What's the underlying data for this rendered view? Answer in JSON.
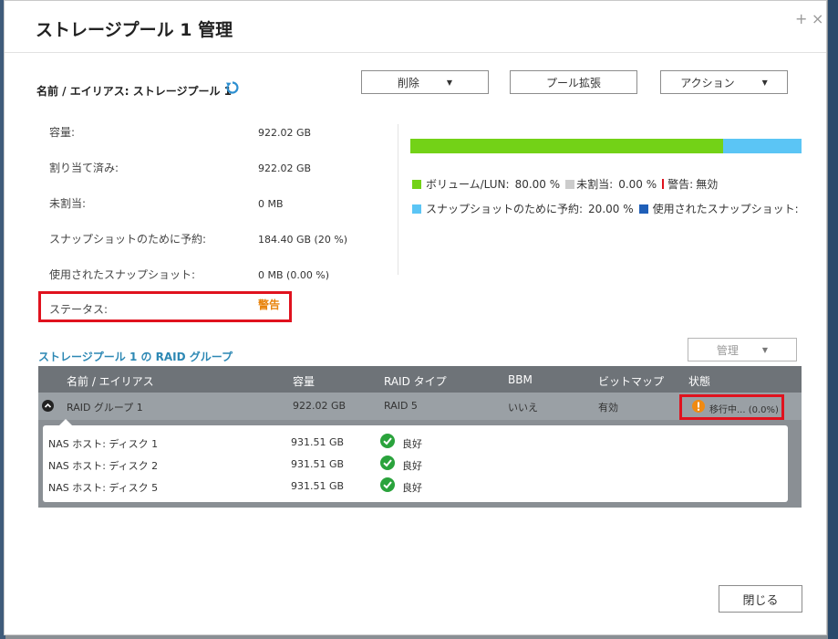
{
  "dialog": {
    "title": "ストレージプール 1 管理",
    "name_line": "名前 / エイリアス: ストレージプール 1"
  },
  "toolbar": {
    "delete_label": "削除",
    "expand_label": "プール拡張",
    "action_label": "アクション"
  },
  "info": {
    "rows": [
      {
        "label": "容量:",
        "value": "922.02 GB"
      },
      {
        "label": "割り当て済み:",
        "value": "922.02 GB"
      },
      {
        "label": "未割当:",
        "value": "0 MB"
      },
      {
        "label": "スナップショットのために予約:",
        "value": "184.40 GB (20 %)"
      },
      {
        "label": "使用されたスナップショット:",
        "value": "0 MB (0.00 %)"
      }
    ],
    "status_label": "ステータス:",
    "status_value": "警告"
  },
  "usage": {
    "volume_fraction": 0.8,
    "colors": {
      "volume": "#73d217",
      "unallocated": "#cccccc",
      "warning": "#e0121e",
      "snapshot_reserved": "#5bc5f5",
      "snapshot_used": "#1f5fb8"
    },
    "legend": {
      "volume": "ボリューム/LUN:",
      "volume_value": "80.00 %",
      "unallocated": "未割当:",
      "unallocated_value": "0.00 %",
      "warning": "警告:",
      "warning_value": "無効",
      "snapshot_reserved": "スナップショットのために予約:",
      "snapshot_reserved_value": "20.00 %",
      "snapshot_used": "使用されたスナップショット:"
    }
  },
  "raid": {
    "section_title": "ストレージプール 1 の RAID グループ",
    "manage_label": "管理",
    "columns": [
      "名前 / エイリアス",
      "容量",
      "RAID タイプ",
      "BBM",
      "ビットマップ",
      "状態"
    ],
    "group": {
      "name": "RAID グループ 1",
      "capacity": "922.02 GB",
      "raid_type": "RAID 5",
      "bbm": "いいえ",
      "bitmap": "有効",
      "state": "移行中... (0.0%)"
    },
    "disks": [
      {
        "name": "NAS ホスト: ディスク 1",
        "capacity": "931.51 GB",
        "status": "良好"
      },
      {
        "name": "NAS ホスト: ディスク 2",
        "capacity": "931.51 GB",
        "status": "良好"
      },
      {
        "name": "NAS ホスト: ディスク 5",
        "capacity": "931.51 GB",
        "status": "良好"
      }
    ]
  },
  "footer": {
    "close_label": "閉じる"
  }
}
